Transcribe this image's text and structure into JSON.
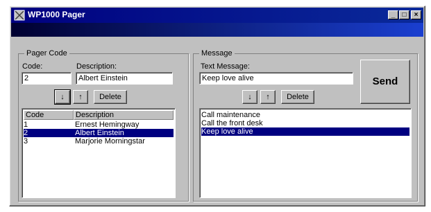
{
  "window": {
    "title": "WP1000 Pager",
    "icon": "pager-app-icon",
    "controls": [
      "_",
      "□",
      "×"
    ]
  },
  "pager_code": {
    "group_label": "Pager Code",
    "code_label": "Code:",
    "description_label": "Description:",
    "code_value": "2",
    "description_value": "Albert Einstein",
    "down_arrow": "↓",
    "up_arrow": "↑",
    "delete_label": "Delete",
    "columns": [
      "Code",
      "Description"
    ],
    "rows": [
      {
        "code": "1",
        "description": "Ernest Hemingway"
      },
      {
        "code": "2",
        "description": "Albert Einstein"
      },
      {
        "code": "3",
        "description": "Marjorie Morningstar"
      }
    ],
    "selected_index": 1
  },
  "message": {
    "group_label": "Message",
    "text_label": "Text Message:",
    "text_value": "Keep love alive",
    "down_arrow": "↓",
    "up_arrow": "↑",
    "delete_label": "Delete",
    "send_label": "Send",
    "items": [
      "Call maintenance",
      "Call the front desk",
      "Keep love alive"
    ],
    "selected_index": 2
  }
}
